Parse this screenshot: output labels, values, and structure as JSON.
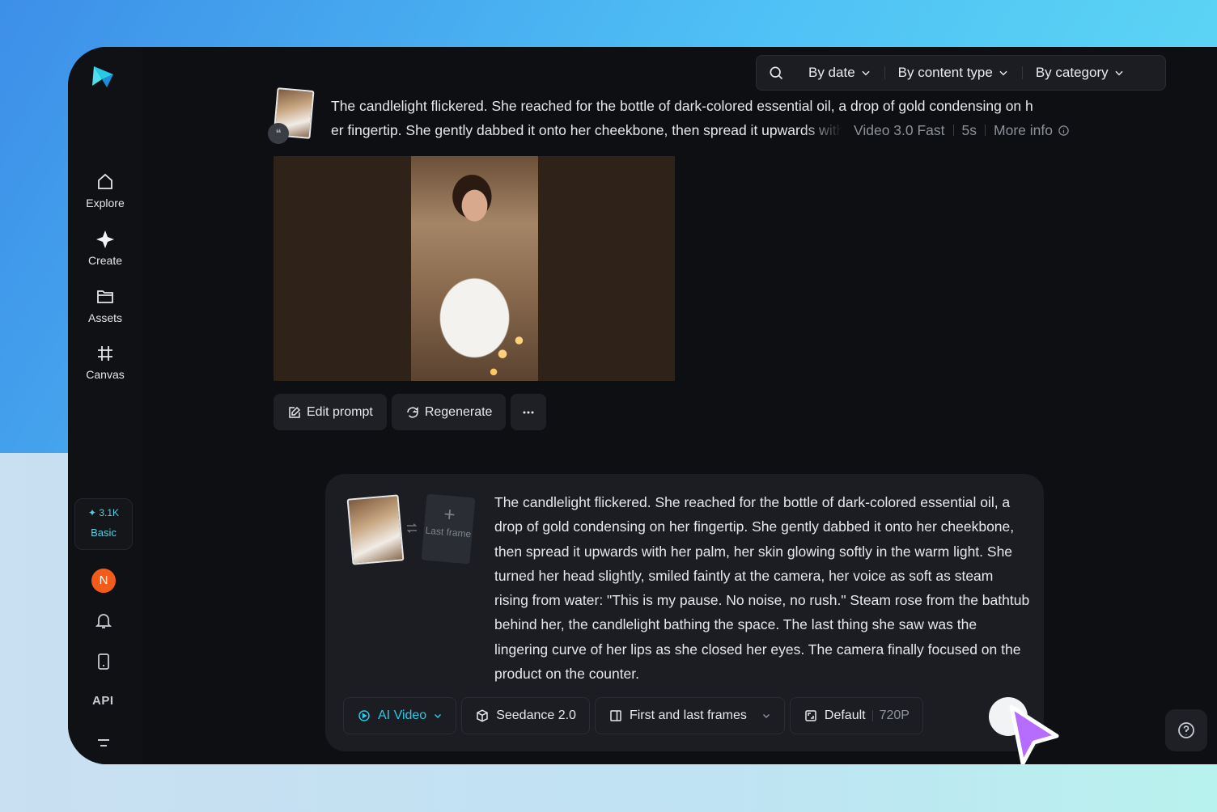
{
  "sidebar": {
    "items": [
      {
        "label": "Explore",
        "icon": "home-icon"
      },
      {
        "label": "Create",
        "icon": "sparkle-icon"
      },
      {
        "label": "Assets",
        "icon": "folder-icon"
      },
      {
        "label": "Canvas",
        "icon": "canvas-icon"
      }
    ],
    "credits": {
      "value": "3.1K",
      "plan": "Basic"
    },
    "avatar_initial": "N",
    "api_label": "API"
  },
  "filters": {
    "by_date": "By date",
    "by_content_type": "By content type",
    "by_category": "By category"
  },
  "generation": {
    "prompt_line1": "The candlelight flickered. She reached for the bottle of dark-colored essential oil, a drop of gold condensing on h",
    "prompt_line2": "er fingertip. She gently dabbed it onto her cheekbone, then spread it upwards with her palm",
    "model": "Video 3.0 Fast",
    "duration": "5s",
    "more_info": "More info",
    "actions": {
      "edit": "Edit prompt",
      "regenerate": "Regenerate"
    }
  },
  "composer": {
    "last_frame_label": "Last frame",
    "prompt": "The candlelight flickered. She reached for the bottle of dark-colored essential oil, a drop of gold condensing on her fingertip. She gently dabbed it onto her cheekbone, then spread it upwards with her palm, her skin glowing softly in the warm light. She turned her head slightly, smiled faintly at the camera, her voice as soft as steam rising from water: \"This is my pause. No noise, no rush.\" Steam rose from the bathtub behind her, the candlelight bathing the space. The last thing she saw was the lingering curve of her lips as she closed her eyes. The camera finally focused on the product on the counter.",
    "mode": "AI Video",
    "model": "Seedance 2.0",
    "frames_mode": "First and last frames",
    "ratio": "Default",
    "resolution": "720P"
  },
  "colors": {
    "accent": "#2bc9e6",
    "avatar": "#f35b1a",
    "cursor": "#b66dff"
  }
}
